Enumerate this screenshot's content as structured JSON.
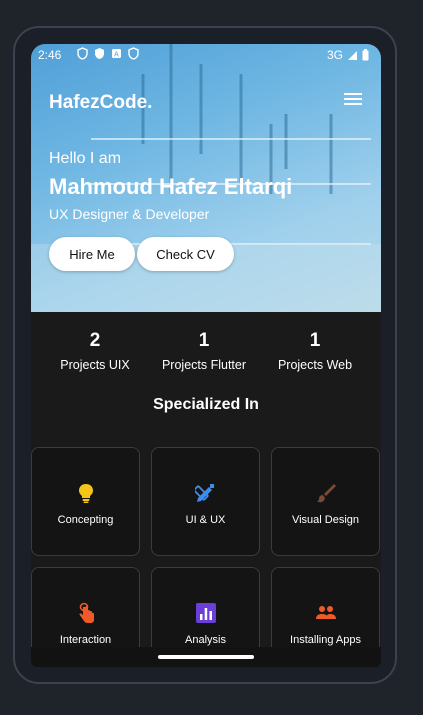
{
  "status_bar": {
    "time": "2:46",
    "network": "3G"
  },
  "header": {
    "logo": "HafezCode."
  },
  "hero": {
    "greeting": "Hello I am",
    "name": "Mahmoud Hafez Eltarqi",
    "role": "UX Designer & Developer",
    "hire_label": "Hire Me",
    "cv_label": "Check CV"
  },
  "stats": [
    {
      "value": "2",
      "label": "Projects UIX"
    },
    {
      "value": "1",
      "label": "Projects Flutter"
    },
    {
      "value": "1",
      "label": "Projects Web"
    }
  ],
  "specialized": {
    "title": "Specialized In",
    "items": [
      {
        "label": "Concepting",
        "icon": "lightbulb-icon",
        "color": "#f5c518"
      },
      {
        "label": "UI & UX",
        "icon": "design-tools-icon",
        "color": "#3b8ef0"
      },
      {
        "label": "Visual Design",
        "icon": "brush-icon",
        "color": "#7a4a35"
      },
      {
        "label": "Interaction",
        "icon": "touch-icon",
        "color": "#f05a28"
      },
      {
        "label": "Analysis",
        "icon": "analytics-icon",
        "color": "#6a3fd8"
      },
      {
        "label": "Installing Apps",
        "icon": "groups-icon",
        "color": "#f05a28"
      }
    ]
  }
}
